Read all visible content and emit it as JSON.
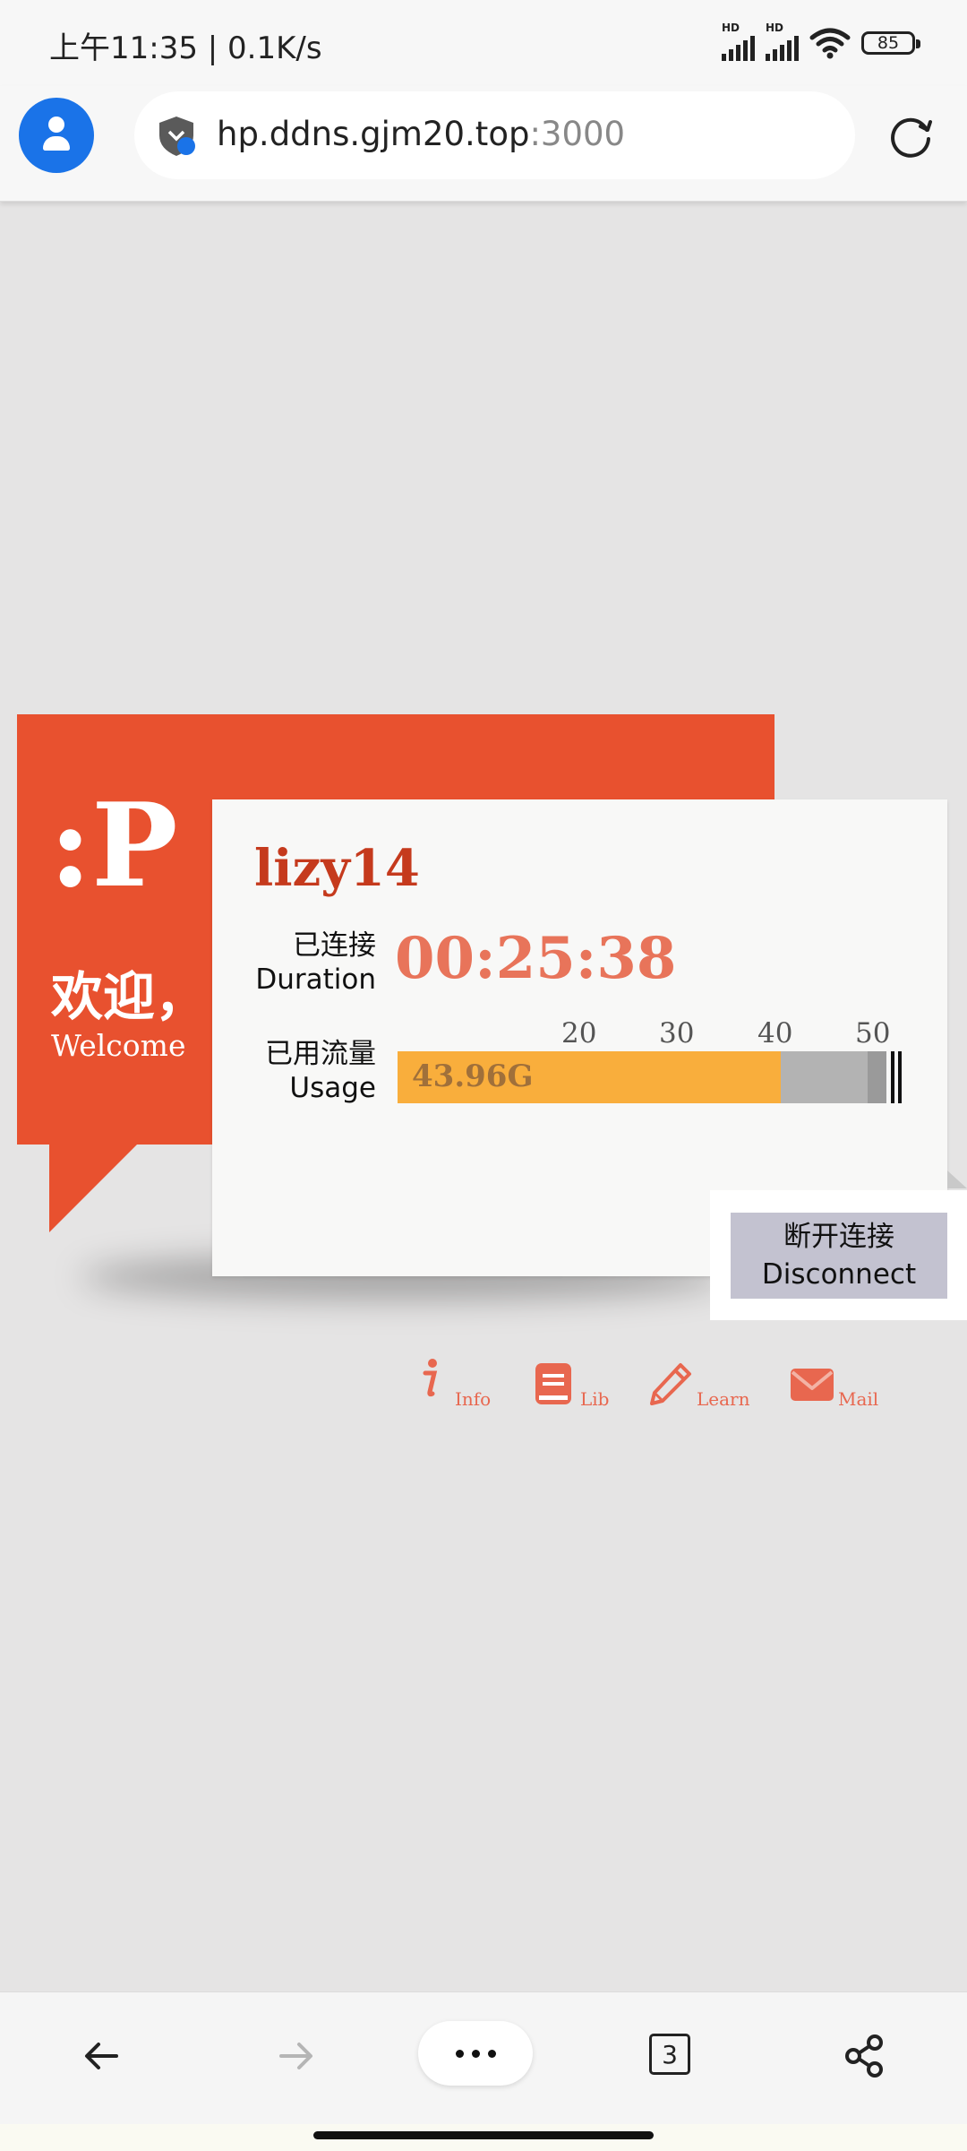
{
  "status_bar": {
    "time_speed": "上午11:35 | 0.1K/s",
    "signal_labels": [
      "HD",
      "HD"
    ],
    "battery": "85",
    "icons": [
      "signal-icon",
      "signal-icon",
      "wifi-icon",
      "battery-icon"
    ]
  },
  "browser": {
    "url_host": "hp.ddns.gjm20.top",
    "url_port": ":3000",
    "icons": [
      "profile-icon",
      "security-shield-icon",
      "reload-icon"
    ]
  },
  "welcome": {
    "big_text": ":P",
    "greeting_cn": "欢迎，",
    "greeting_en": "Welcome"
  },
  "session": {
    "username": "lizy14",
    "duration_label_cn": "已连接",
    "duration_label_en": "Duration",
    "duration_value": "00:25:38",
    "usage_label_cn": "已用流量",
    "usage_label_en": "Usage",
    "usage_value_text": "43.96G",
    "usage_scale_ticks": [
      "20",
      "30",
      "40",
      "50"
    ],
    "usage_gb": 43.96,
    "usage_scale_max_gb": 50,
    "usage_light_band_gb": 49.5
  },
  "actions": {
    "disconnect_cn": "断开连接",
    "disconnect_en": "Disconnect"
  },
  "links": [
    {
      "label": "Info",
      "icon": "info-icon"
    },
    {
      "label": "Lib",
      "icon": "book-icon"
    },
    {
      "label": "Learn",
      "icon": "pencil-icon"
    },
    {
      "label": "Mail",
      "icon": "mail-icon"
    }
  ],
  "bottom_nav": {
    "tab_count": "3",
    "icons": [
      "back-arrow-icon",
      "forward-arrow-icon",
      "more-icon",
      "tabs-icon",
      "share-icon"
    ]
  },
  "colors": {
    "brand_red": "#e8512f",
    "duration_color": "#e8745a",
    "usage_fill": "#f9ae3c",
    "link_color": "#e8674f",
    "profile_blue": "#1a73e8"
  }
}
